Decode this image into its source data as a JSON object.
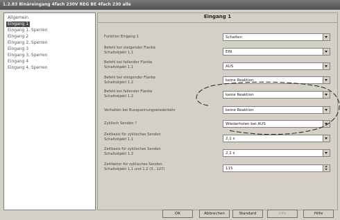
{
  "window": {
    "title": "1.2.83 Binäreingang 4fach 230V REG BE 4fach 230 alle"
  },
  "tree": {
    "items": [
      {
        "label": "Allgemein",
        "selected": false
      },
      {
        "label": "Eingang 1",
        "selected": true
      },
      {
        "label": "Eingang 1, Sperren",
        "selected": false
      },
      {
        "label": "Eingang 2",
        "selected": false
      },
      {
        "label": "Eingang 2, Sperren",
        "selected": false
      },
      {
        "label": "Eingang 3",
        "selected": false
      },
      {
        "label": "Eingang 3, Sperren",
        "selected": false
      },
      {
        "label": "Eingang 4",
        "selected": false
      },
      {
        "label": "Eingang 4, Sperren",
        "selected": false
      }
    ]
  },
  "panel": {
    "title": "Eingang 1",
    "params": [
      {
        "label": [
          "Funktion Eingang 1"
        ],
        "value": "Schalten",
        "control": "dropdown"
      },
      {
        "label": [
          "Befehl bei steigender Flanke",
          "Schaltobjekt 1.1"
        ],
        "value": "EIN",
        "control": "dropdown"
      },
      {
        "label": [
          "Befehl bei fallender Flanke",
          "Schaltobjekt 1.1"
        ],
        "value": "AUS",
        "control": "dropdown"
      },
      {
        "label": [
          "Befehl bei steigender Flanke",
          "Schaltobjekt 1.2"
        ],
        "value": "keine Reaktion",
        "control": "dropdown"
      },
      {
        "label": [
          "Befehl bei fallender Flanke",
          "Schaltobjekt 1.2"
        ],
        "value": "keine Reaktion",
        "control": "dropdown"
      },
      {
        "label": [
          "Verhalten bei Busspannungswiederkehr"
        ],
        "value": "keine Reaktion",
        "control": "dropdown"
      },
      {
        "label": [
          "Zyklisch Senden ?"
        ],
        "value": "Wiederholen bei AUS",
        "control": "dropdown"
      },
      {
        "label": [
          "Zeitbasis für zyklisches Senden",
          "Schaltobjekt 1.1"
        ],
        "value": "2,1 s",
        "control": "dropdown"
      },
      {
        "label": [
          "Zeitbasis für zyklisches Senden",
          "Schaltobjekt 1.2"
        ],
        "value": "2,1 s",
        "control": "dropdown"
      },
      {
        "label": [
          "Zeitfaktor für zyklisches Senden",
          "Schaltobjekt 1.1 und 1.2 (3...127)"
        ],
        "value": "115",
        "control": "spinner"
      }
    ]
  },
  "buttons": {
    "ok": "OK",
    "cancel": "Abbrechen",
    "default": "Standard",
    "info": "Info",
    "help": "Hilfe"
  },
  "colors": {
    "selection": "#4a4a4a",
    "dialog_bg": "#d4d0c8"
  }
}
